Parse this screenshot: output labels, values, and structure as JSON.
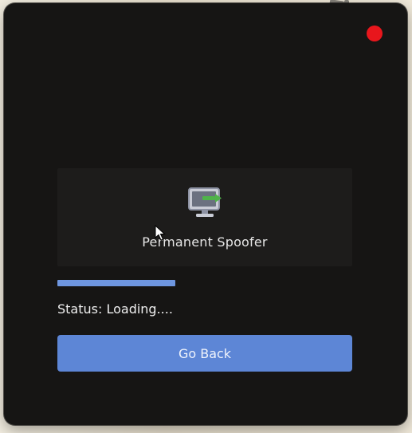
{
  "window": {
    "close_color": "#e8161c"
  },
  "card": {
    "icon": "monitor-icon",
    "title": "Permanent Spoofer"
  },
  "progress": {
    "value": 0.4,
    "color": "#6e96e0"
  },
  "status": {
    "text": "Status: Loading...."
  },
  "actions": {
    "go_back_label": "Go Back",
    "accent": "#5d86d6"
  }
}
